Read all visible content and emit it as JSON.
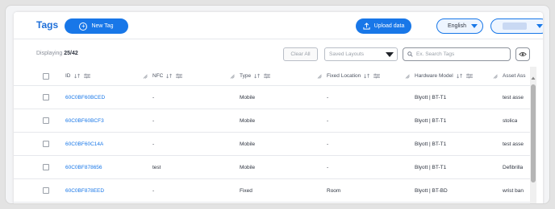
{
  "header": {
    "title": "Tags",
    "new_tag_label": "New Tag",
    "upload_label": "Upload data",
    "language": "English"
  },
  "toolbar": {
    "displaying_label": "Displaying",
    "displaying_count": "25/42",
    "clear_all_label": "Clear All",
    "layouts_placeholder": "Saved Layouts",
    "search_placeholder": "Ex. Search Tags"
  },
  "table": {
    "columns": [
      "ID",
      "NFC",
      "Type",
      "Fixed Location",
      "Hardware Model",
      "Asset Ass"
    ],
    "rows": [
      {
        "id": "60C0BF60BCED",
        "nfc": "-",
        "type": "Mobile",
        "location": "-",
        "model": "Blyott | BT-T1",
        "asset": "test asse"
      },
      {
        "id": "60C0BF60BCF3",
        "nfc": "-",
        "type": "Mobile",
        "location": "-",
        "model": "Blyott | BT-T1",
        "asset": "stolica"
      },
      {
        "id": "60C0BF60C14A",
        "nfc": "-",
        "type": "Mobile",
        "location": "-",
        "model": "Blyott | BT-T1",
        "asset": "test asse"
      },
      {
        "id": "60C0BF878656",
        "nfc": "test",
        "type": "Mobile",
        "location": "-",
        "model": "Blyott | BT-T1",
        "asset": "Defibrilla"
      },
      {
        "id": "60C0BF878EED",
        "nfc": "-",
        "type": "Fixed",
        "location": "Room",
        "model": "Blyott | BT-BD",
        "asset": "wrist ban"
      }
    ]
  },
  "colors": {
    "accent": "#1877e8",
    "link": "#1877e8",
    "border": "#e6e8ec"
  }
}
